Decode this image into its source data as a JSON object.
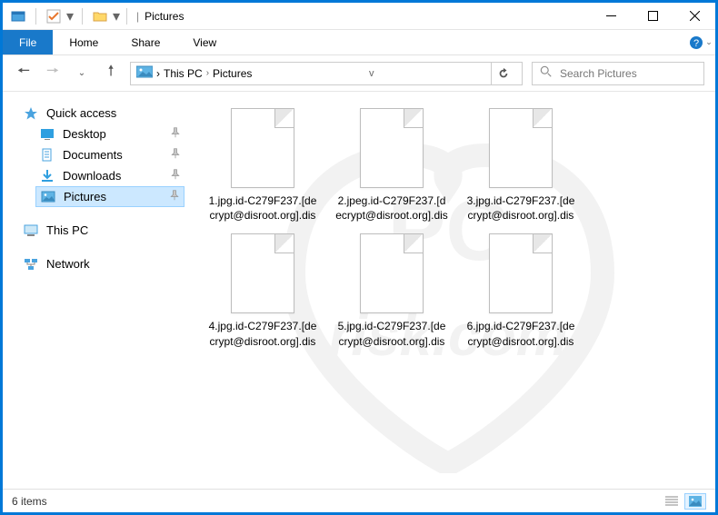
{
  "titlebar": {
    "title": "Pictures"
  },
  "menubar": {
    "file_label": "File",
    "tabs": [
      "Home",
      "Share",
      "View"
    ]
  },
  "breadcrumb": {
    "segments": [
      "This PC",
      "Pictures"
    ],
    "dropdown_v": "v"
  },
  "search": {
    "placeholder": "Search Pictures"
  },
  "sidebar": {
    "quick_access": "Quick access",
    "items": [
      {
        "label": "Desktop",
        "pinned": true
      },
      {
        "label": "Documents",
        "pinned": true
      },
      {
        "label": "Downloads",
        "pinned": true
      },
      {
        "label": "Pictures",
        "pinned": true,
        "selected": true
      }
    ],
    "this_pc": "This PC",
    "network": "Network"
  },
  "files": [
    {
      "name": "1.jpg.id-C279F237.[decrypt@disroot.org].dis"
    },
    {
      "name": "2.jpeg.id-C279F237.[decrypt@disroot.org].dis"
    },
    {
      "name": "3.jpg.id-C279F237.[decrypt@disroot.org].dis"
    },
    {
      "name": "4.jpg.id-C279F237.[decrypt@disroot.org].dis"
    },
    {
      "name": "5.jpg.id-C279F237.[decrypt@disroot.org].dis"
    },
    {
      "name": "6.jpg.id-C279F237.[decrypt@disroot.org].dis"
    }
  ],
  "statusbar": {
    "count_label": "6 items"
  },
  "watermark": {
    "line1": "PC",
    "line2": "risk.com"
  }
}
